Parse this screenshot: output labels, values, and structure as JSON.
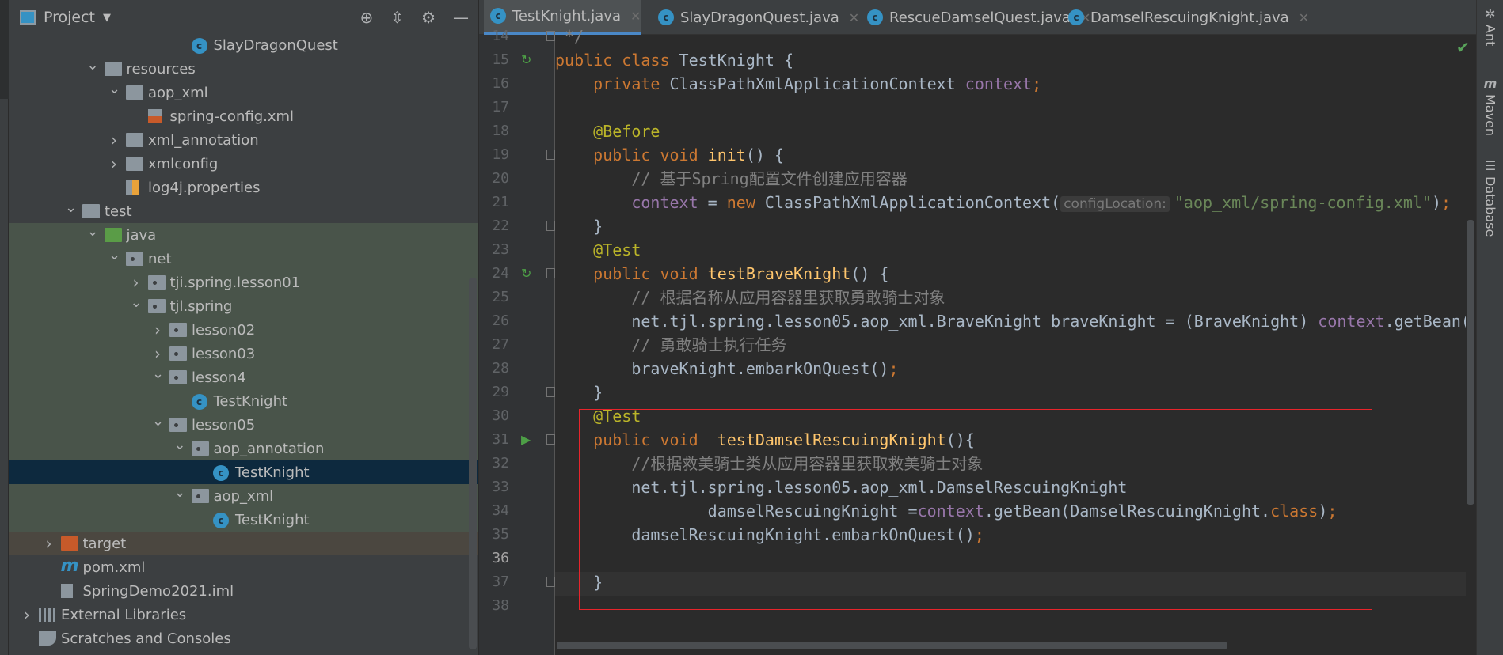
{
  "project": {
    "title": "Project",
    "tools": [
      "locate-icon",
      "collapse-all-icon",
      "gear-icon",
      "minimize-icon"
    ],
    "tree": [
      {
        "label": "SlayDragonQuest",
        "level": 7,
        "type": "class",
        "bg": ""
      },
      {
        "label": "resources",
        "level": 3,
        "type": "folder",
        "expanded": true,
        "bg": ""
      },
      {
        "label": "aop_xml",
        "level": 4,
        "type": "folder",
        "expanded": true,
        "bg": ""
      },
      {
        "label": "spring-config.xml",
        "level": 5,
        "type": "xml",
        "bg": ""
      },
      {
        "label": "xml_annotation",
        "level": 4,
        "type": "folder",
        "expanded": false,
        "bg": ""
      },
      {
        "label": "xmlconfig",
        "level": 4,
        "type": "folder",
        "expanded": false,
        "bg": ""
      },
      {
        "label": "log4j.properties",
        "level": 4,
        "type": "props",
        "bg": ""
      },
      {
        "label": "test",
        "level": 2,
        "type": "folder",
        "expanded": true,
        "bg": ""
      },
      {
        "label": "java",
        "level": 3,
        "type": "testroot",
        "expanded": true,
        "bg": "test"
      },
      {
        "label": "net",
        "level": 4,
        "type": "package",
        "expanded": true,
        "bg": "test"
      },
      {
        "label": "tji.spring.lesson01",
        "level": 5,
        "type": "package",
        "expanded": false,
        "bg": "test"
      },
      {
        "label": "tjl.spring",
        "level": 5,
        "type": "package",
        "expanded": true,
        "bg": "test"
      },
      {
        "label": "lesson02",
        "level": 6,
        "type": "package",
        "expanded": false,
        "bg": "test"
      },
      {
        "label": "lesson03",
        "level": 6,
        "type": "package",
        "expanded": false,
        "bg": "test"
      },
      {
        "label": "lesson4",
        "level": 6,
        "type": "package",
        "expanded": true,
        "bg": "test"
      },
      {
        "label": "TestKnight",
        "level": 7,
        "type": "class",
        "bg": "test"
      },
      {
        "label": "lesson05",
        "level": 6,
        "type": "package",
        "expanded": true,
        "bg": "test"
      },
      {
        "label": "aop_annotation",
        "level": 7,
        "type": "package",
        "expanded": true,
        "bg": "test"
      },
      {
        "label": "TestKnight",
        "level": 8,
        "type": "class",
        "bg": "sel"
      },
      {
        "label": "aop_xml",
        "level": 7,
        "type": "package",
        "expanded": true,
        "bg": "test"
      },
      {
        "label": "TestKnight",
        "level": 8,
        "type": "class",
        "bg": "test"
      },
      {
        "label": "target",
        "level": 1,
        "type": "excluded",
        "expanded": false,
        "bg": "excl"
      },
      {
        "label": "pom.xml",
        "level": 1,
        "type": "maven",
        "bg": ""
      },
      {
        "label": "SpringDemo2021.iml",
        "level": 1,
        "type": "iml",
        "bg": ""
      },
      {
        "label": "External Libraries",
        "level": 0,
        "type": "libs",
        "expanded": false,
        "bg": ""
      },
      {
        "label": "Scratches and Consoles",
        "level": 0,
        "type": "scratch",
        "bg": ""
      }
    ]
  },
  "editor": {
    "tabs": [
      {
        "label": "TestKnight.java",
        "active": true
      },
      {
        "label": "SlayDragonQuest.java"
      },
      {
        "label": "RescueDamselQuest.java"
      },
      {
        "label": "DamselRescuingKnight.java"
      }
    ],
    "current_line": 36,
    "inspection_status": "ok",
    "lines": [
      {
        "n": 14,
        "fold": true,
        "t": [
          [
            "c",
            " */"
          ]
        ]
      },
      {
        "n": 15,
        "run": "run-refresh",
        "t": [
          [
            "k",
            "public class "
          ],
          [
            "t",
            "TestKnight {"
          ]
        ]
      },
      {
        "n": 16,
        "t": [
          [
            "k",
            "    private "
          ],
          [
            "t",
            "ClassPathXmlApplicationContext "
          ],
          [
            "f",
            "context"
          ],
          [
            "k",
            ";"
          ]
        ]
      },
      {
        "n": 17,
        "t": []
      },
      {
        "n": 18,
        "t": [
          [
            "a",
            "    @Before"
          ]
        ]
      },
      {
        "n": 19,
        "fold": true,
        "t": [
          [
            "k",
            "    public void "
          ],
          [
            "m",
            "init"
          ],
          [
            "t",
            "() {"
          ]
        ]
      },
      {
        "n": 20,
        "t": [
          [
            "c",
            "        // 基于Spring配置文件创建应用容器"
          ]
        ]
      },
      {
        "n": 21,
        "t": [
          [
            "f",
            "        context "
          ],
          [
            "t",
            "= "
          ],
          [
            "k",
            "new "
          ],
          [
            "t",
            "ClassPathXmlApplicationContext("
          ],
          [
            "h",
            "configLocation:"
          ],
          [
            "s",
            "\"aop_xml/spring-config.xml\""
          ],
          [
            "t",
            ")"
          ],
          [
            "k",
            ";"
          ]
        ]
      },
      {
        "n": 22,
        "fold": true,
        "t": [
          [
            "t",
            "    }"
          ]
        ]
      },
      {
        "n": 23,
        "t": [
          [
            "a",
            "    @Test"
          ]
        ]
      },
      {
        "n": 24,
        "run": "run-refresh",
        "fold": true,
        "t": [
          [
            "k",
            "    public void "
          ],
          [
            "m",
            "testBraveKnight"
          ],
          [
            "t",
            "() {"
          ]
        ]
      },
      {
        "n": 25,
        "t": [
          [
            "c",
            "        // 根据名称从应用容器里获取勇敢骑士对象"
          ]
        ]
      },
      {
        "n": 26,
        "t": [
          [
            "t",
            "        net.tjl.spring.lesson05.aop_xml.BraveKnight braveKnight = (BraveKnight) "
          ],
          [
            "f",
            "context"
          ],
          [
            "t",
            ".getBean("
          ]
        ]
      },
      {
        "n": 27,
        "t": [
          [
            "c",
            "        // 勇敢骑士执行任务"
          ]
        ]
      },
      {
        "n": 28,
        "t": [
          [
            "t",
            "        braveKnight.embarkOnQuest()"
          ],
          [
            "k",
            ";"
          ]
        ]
      },
      {
        "n": 29,
        "fold": true,
        "t": [
          [
            "t",
            "    }"
          ]
        ]
      },
      {
        "n": 30,
        "t": [
          [
            "a",
            "    @Test"
          ]
        ]
      },
      {
        "n": 31,
        "run": "run",
        "fold": true,
        "t": [
          [
            "k",
            "    public void  "
          ],
          [
            "m",
            "testDamselRescuingKnight"
          ],
          [
            "t",
            "(){"
          ]
        ]
      },
      {
        "n": 32,
        "t": [
          [
            "c",
            "        //根据救美骑士类从应用容器里获取救美骑士对象"
          ]
        ]
      },
      {
        "n": 33,
        "t": [
          [
            "t",
            "        net.tjl.spring.lesson05.aop_xml.DamselRescuingKnight"
          ]
        ]
      },
      {
        "n": 34,
        "t": [
          [
            "t",
            "                damselRescuingKnight ="
          ],
          [
            "f",
            "context"
          ],
          [
            "t",
            ".getBean(DamselRescuingKnight."
          ],
          [
            "k",
            "class"
          ],
          [
            "t",
            ")"
          ],
          [
            "k",
            ";"
          ]
        ]
      },
      {
        "n": 35,
        "t": [
          [
            "t",
            "        damselRescuingKnight.embarkOnQuest()"
          ],
          [
            "k",
            ";"
          ]
        ]
      },
      {
        "n": 36,
        "t": []
      },
      {
        "n": 37,
        "fold": true,
        "t": [
          [
            "t",
            "    }"
          ]
        ]
      },
      {
        "n": 38,
        "t": []
      }
    ]
  },
  "right_tools": [
    {
      "label": "Ant",
      "icon": "ant-icon"
    },
    {
      "label": "Maven",
      "icon": "maven-icon"
    },
    {
      "label": "Database",
      "icon": "database-icon"
    }
  ],
  "colors": {
    "keyword": "#cc7832",
    "annotation": "#bbb529",
    "method": "#ffc66d",
    "field": "#9876aa",
    "string": "#6a8759",
    "comment": "#808080",
    "highlight_box": "#e8242b"
  }
}
